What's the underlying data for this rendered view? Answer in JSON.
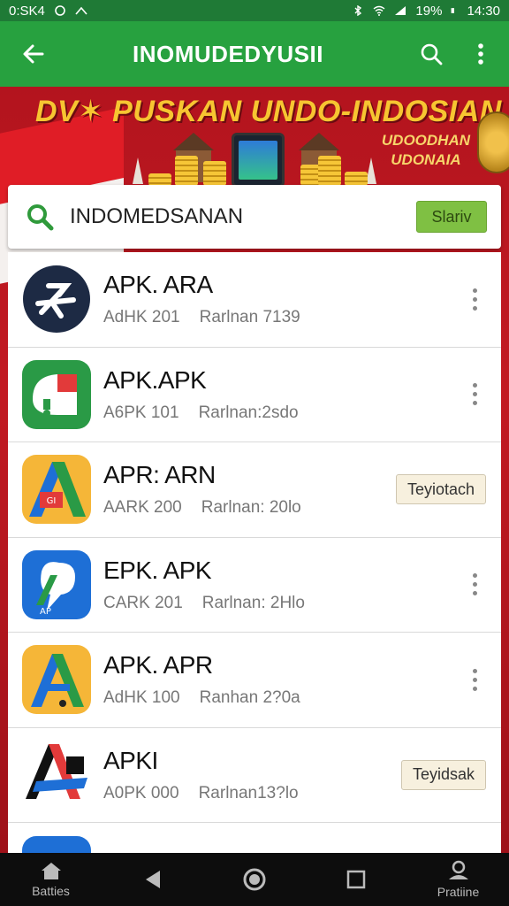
{
  "status_bar": {
    "left_text": "0:SK4",
    "battery": "19%",
    "time": "14:30"
  },
  "app_bar": {
    "title": "INOMUDEDYUSII",
    "back_icon": "arrow-left-icon",
    "search_icon": "search-icon",
    "more_icon": "more-vert-icon"
  },
  "banner": {
    "headline": "DV✶ PUSKAN UNDO-INDOSIAN",
    "subline_1": "UDOODHAN",
    "subline_2": "UDONAIA"
  },
  "search": {
    "query": "INDOMEDSANAN",
    "button_label": "Slariv"
  },
  "apps": [
    {
      "name": "APK. ARA",
      "meta_a": "AdHK 201",
      "meta_b": "Rarlnan 7139",
      "action": "kebab"
    },
    {
      "name": "APK.APK",
      "meta_a": "A6PK 101",
      "meta_b": "Rarlnan:2sdo",
      "action": "kebab"
    },
    {
      "name": "APR: ARN",
      "meta_a": "AARK 200",
      "meta_b": "Rarlnan: 20lo",
      "action": "button",
      "action_label": "Teyiotach"
    },
    {
      "name": "EPK. APK",
      "meta_a": "CARK 201",
      "meta_b": "Rarlnan: 2Hlo",
      "action": "kebab"
    },
    {
      "name": "APK. APR",
      "meta_a": "AdHK 100",
      "meta_b": "Ranhan 2?0a",
      "action": "kebab"
    },
    {
      "name": "APKI",
      "meta_a": "A0PK 000",
      "meta_b": "Rarlnan13?lo",
      "action": "button",
      "action_label": "Teyidsak"
    }
  ],
  "nav": {
    "left_label": "Batties",
    "right_label": "Pratiine"
  },
  "colors": {
    "primary": "#27a13f",
    "status": "#1f7a36",
    "banner_red": "#c21a22",
    "accent_gold": "#f7c531",
    "go_button": "#7fc043"
  }
}
